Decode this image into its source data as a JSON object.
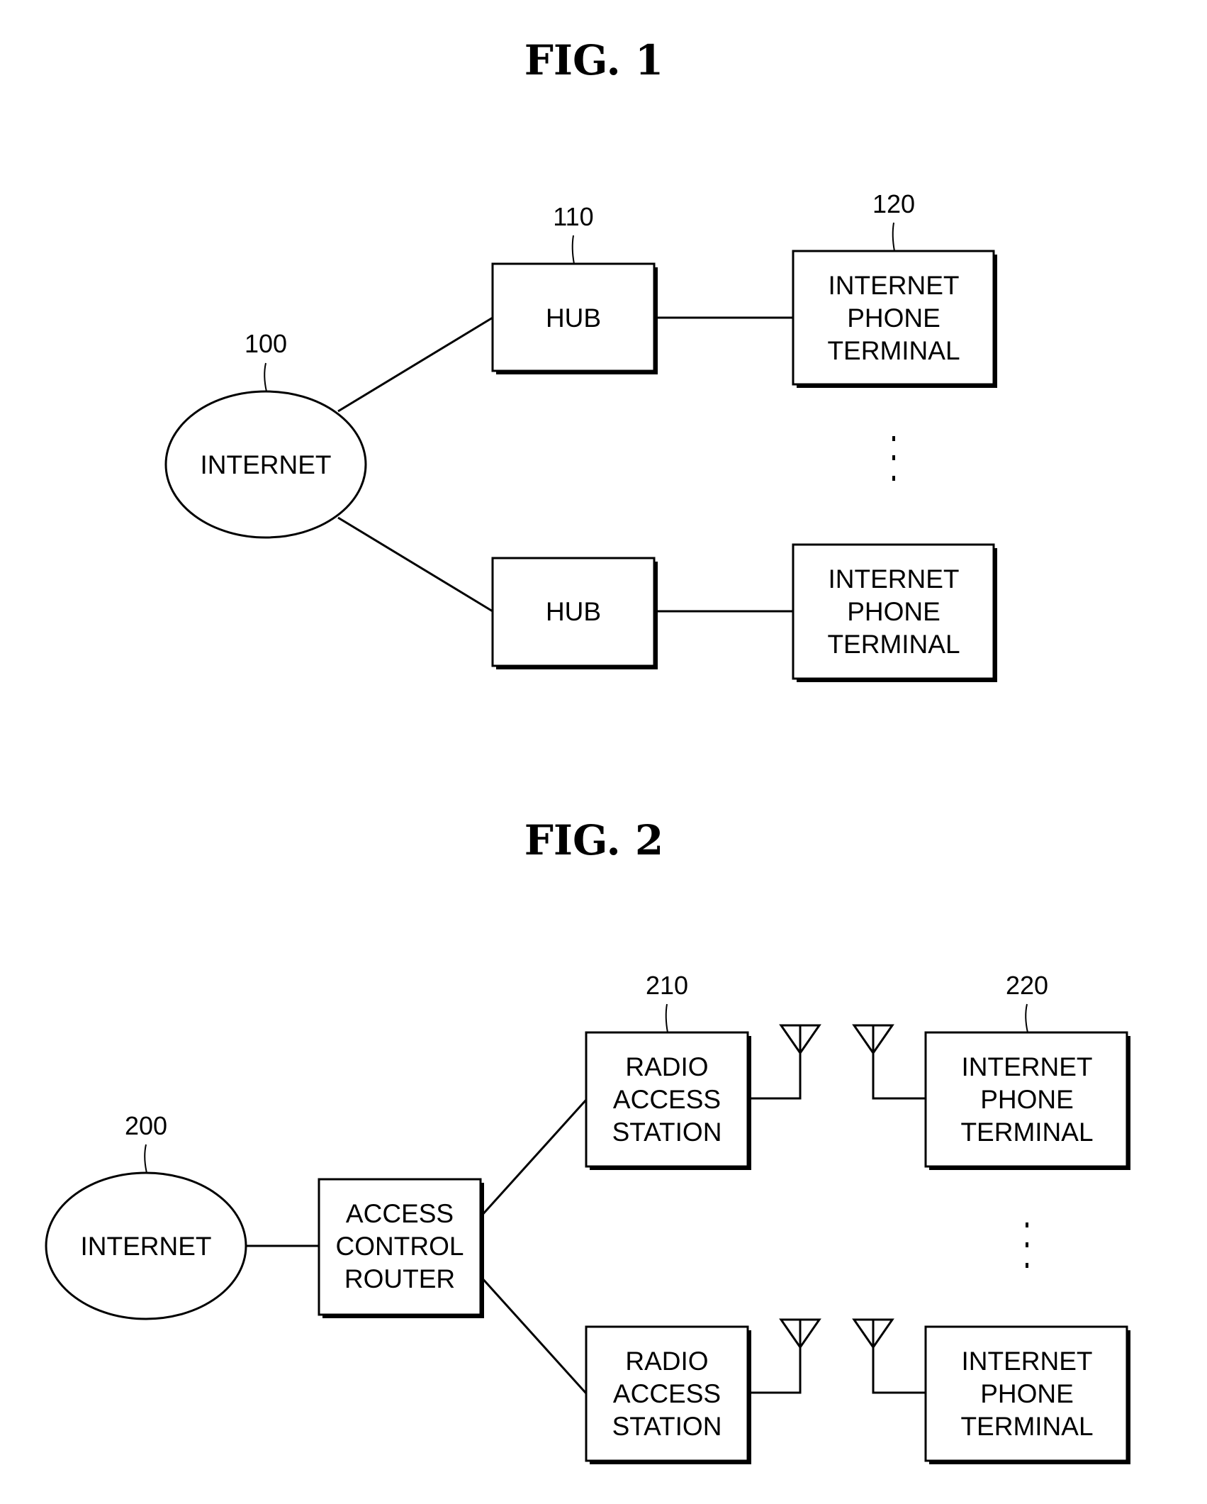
{
  "figures": [
    {
      "title": "FIG. 1",
      "nodes": {
        "internet": {
          "label": "INTERNET",
          "ref": "100"
        },
        "hub_top": {
          "label": "HUB",
          "ref": "110"
        },
        "hub_bottom": {
          "label": "HUB"
        },
        "terminal_top": {
          "lines": [
            "INTERNET",
            "PHONE",
            "TERMINAL"
          ],
          "ref": "120"
        },
        "terminal_bottom": {
          "lines": [
            "INTERNET",
            "PHONE",
            "TERMINAL"
          ]
        }
      },
      "ellipsis": "⋮"
    },
    {
      "title": "FIG. 2",
      "nodes": {
        "internet": {
          "label": "INTERNET",
          "ref": "200"
        },
        "router": {
          "lines": [
            "ACCESS",
            "CONTROL",
            "ROUTER"
          ]
        },
        "station_top": {
          "lines": [
            "RADIO",
            "ACCESS",
            "STATION"
          ],
          "ref": "210"
        },
        "station_bottom": {
          "lines": [
            "RADIO",
            "ACCESS",
            "STATION"
          ]
        },
        "terminal_top": {
          "lines": [
            "INTERNET",
            "PHONE",
            "TERMINAL"
          ],
          "ref": "220"
        },
        "terminal_bottom": {
          "lines": [
            "INTERNET",
            "PHONE",
            "TERMINAL"
          ]
        }
      },
      "ellipsis": "⋮"
    }
  ]
}
